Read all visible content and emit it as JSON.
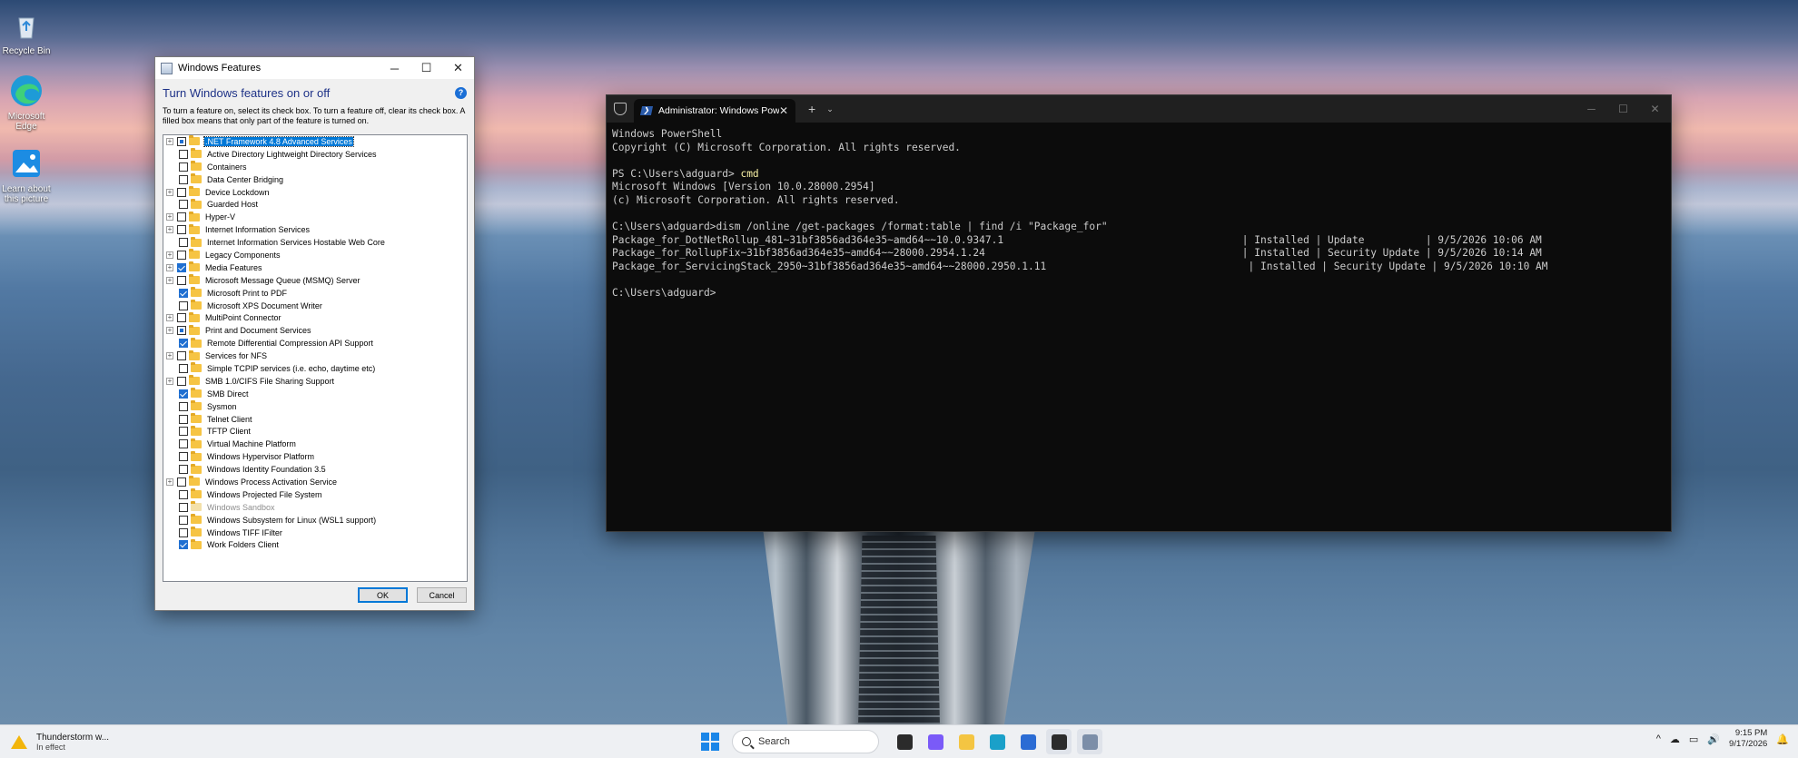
{
  "desktop": {
    "icons": [
      {
        "label": "Recycle Bin",
        "icon": "recycle-bin-icon"
      },
      {
        "label": "Microsoft Edge",
        "icon": "edge-icon"
      },
      {
        "label": "Learn about this picture",
        "icon": "picture-info-icon"
      }
    ]
  },
  "features_dialog": {
    "title": "Windows Features",
    "heading": "Turn Windows features on or off",
    "description": "To turn a feature on, select its check box. To turn a feature off, clear its check box. A filled box means that only part of the feature is turned on.",
    "ok": "OK",
    "cancel": "Cancel",
    "caption": {
      "minimize": "─",
      "maximize": "☐",
      "close": "✕"
    },
    "features": [
      {
        "label": ".NET Framework 4.8 Advanced Services",
        "state": "partial",
        "expandable": true,
        "selected": true
      },
      {
        "label": "Active Directory Lightweight Directory Services",
        "state": "off",
        "expandable": false
      },
      {
        "label": "Containers",
        "state": "off",
        "expandable": false
      },
      {
        "label": "Data Center Bridging",
        "state": "off",
        "expandable": false
      },
      {
        "label": "Device Lockdown",
        "state": "off",
        "expandable": true
      },
      {
        "label": "Guarded Host",
        "state": "off",
        "expandable": false
      },
      {
        "label": "Hyper-V",
        "state": "off",
        "expandable": true
      },
      {
        "label": "Internet Information Services",
        "state": "off",
        "expandable": true
      },
      {
        "label": "Internet Information Services Hostable Web Core",
        "state": "off",
        "expandable": false
      },
      {
        "label": "Legacy Components",
        "state": "off",
        "expandable": true
      },
      {
        "label": "Media Features",
        "state": "checked",
        "expandable": true
      },
      {
        "label": "Microsoft Message Queue (MSMQ) Server",
        "state": "off",
        "expandable": true
      },
      {
        "label": "Microsoft Print to PDF",
        "state": "checked",
        "expandable": false
      },
      {
        "label": "Microsoft XPS Document Writer",
        "state": "off",
        "expandable": false
      },
      {
        "label": "MultiPoint Connector",
        "state": "off",
        "expandable": true
      },
      {
        "label": "Print and Document Services",
        "state": "partial",
        "expandable": true
      },
      {
        "label": "Remote Differential Compression API Support",
        "state": "checked",
        "expandable": false
      },
      {
        "label": "Services for NFS",
        "state": "off",
        "expandable": true
      },
      {
        "label": "Simple TCPIP services (i.e. echo, daytime etc)",
        "state": "off",
        "expandable": false
      },
      {
        "label": "SMB 1.0/CIFS File Sharing Support",
        "state": "off",
        "expandable": true
      },
      {
        "label": "SMB Direct",
        "state": "checked",
        "expandable": false
      },
      {
        "label": "Sysmon",
        "state": "off",
        "expandable": false
      },
      {
        "label": "Telnet Client",
        "state": "off",
        "expandable": false
      },
      {
        "label": "TFTP Client",
        "state": "off",
        "expandable": false
      },
      {
        "label": "Virtual Machine Platform",
        "state": "off",
        "expandable": false
      },
      {
        "label": "Windows Hypervisor Platform",
        "state": "off",
        "expandable": false
      },
      {
        "label": "Windows Identity Foundation 3.5",
        "state": "off",
        "expandable": false
      },
      {
        "label": "Windows Process Activation Service",
        "state": "off",
        "expandable": true
      },
      {
        "label": "Windows Projected File System",
        "state": "off",
        "expandable": false
      },
      {
        "label": "Windows Sandbox",
        "state": "off",
        "expandable": false,
        "disabled": true
      },
      {
        "label": "Windows Subsystem for Linux (WSL1 support)",
        "state": "off",
        "expandable": false
      },
      {
        "label": "Windows TIFF IFilter",
        "state": "off",
        "expandable": false
      },
      {
        "label": "Work Folders Client",
        "state": "checked",
        "expandable": false
      }
    ]
  },
  "terminal": {
    "tab_title": "Administrator: Windows Powe",
    "tab_close": "✕",
    "new_tab": "+",
    "dropdown": "⌄",
    "caption": {
      "minimize": "─",
      "maximize": "☐",
      "close": "✕"
    },
    "lines": [
      {
        "text": "Windows PowerShell"
      },
      {
        "text": "Copyright (C) Microsoft Corporation. All rights reserved."
      },
      {
        "text": ""
      },
      {
        "text": "PS C:\\Users\\adguard> ",
        "cmd": "cmd"
      },
      {
        "text": "Microsoft Windows [Version 10.0.28000.2954]"
      },
      {
        "text": "(c) Microsoft Corporation. All rights reserved."
      },
      {
        "text": ""
      },
      {
        "text": "C:\\Users\\adguard>dism /online /get-packages /format:table | find /i \"Package_for\""
      },
      {
        "text": "Package_for_DotNetRollup_481~31bf3856ad364e35~amd64~~10.0.9347.1                                       | Installed | Update          | 9/5/2026 10:06 AM"
      },
      {
        "text": "Package_for_RollupFix~31bf3856ad364e35~amd64~~28000.2954.1.24                                          | Installed | Security Update | 9/5/2026 10:14 AM"
      },
      {
        "text": "Package_for_ServicingStack_2950~31bf3856ad364e35~amd64~~28000.2950.1.11                                 | Installed | Security Update | 9/5/2026 10:10 AM"
      },
      {
        "text": ""
      },
      {
        "text": "C:\\Users\\adguard>"
      }
    ]
  },
  "taskbar": {
    "weather_title": "Thunderstorm w...",
    "weather_sub": "In effect",
    "search_placeholder": "Search",
    "time": "9:15 PM",
    "date": "9/17/2026",
    "apps": [
      {
        "name": "task-view",
        "color": "#2b2b2b"
      },
      {
        "name": "copilot",
        "color": "#7a5af8"
      },
      {
        "name": "file-explorer",
        "color": "#f4c542"
      },
      {
        "name": "edge",
        "color": "#1aa0c9"
      },
      {
        "name": "store",
        "color": "#2b6cd4"
      },
      {
        "name": "terminal",
        "color": "#2c2c2c",
        "active": true
      },
      {
        "name": "windows-features",
        "color": "#7c8ea8",
        "active": true
      }
    ],
    "tray_icons": [
      "^",
      "☁",
      "▭",
      "🔊"
    ]
  }
}
